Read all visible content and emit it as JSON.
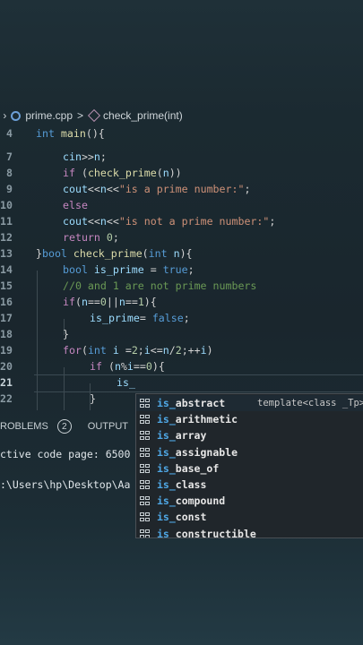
{
  "breadcrumb": {
    "prefix": "‹ ›",
    "file": "prime.cpp",
    "sep": ">",
    "symbol": "check_prime(int)"
  },
  "code_lines": [
    {
      "no": "4",
      "tokens": [
        [
          "kw",
          "int "
        ],
        [
          "fn",
          "main"
        ],
        [
          "pl",
          "(){"
        ]
      ]
    },
    {
      "no": "7",
      "tokens": [
        [
          "var",
          "cin"
        ],
        [
          "pl",
          ">>"
        ],
        [
          "var",
          "n"
        ],
        [
          "pl",
          ";"
        ]
      ]
    },
    {
      "no": "8",
      "tokens": [
        [
          "ctl",
          "if "
        ],
        [
          "pl",
          "("
        ],
        [
          "fn",
          "check_prime"
        ],
        [
          "pl",
          "("
        ],
        [
          "var",
          "n"
        ],
        [
          "pl",
          "))"
        ]
      ]
    },
    {
      "no": "9",
      "tokens": [
        [
          "var",
          "cout"
        ],
        [
          "pl",
          "<<"
        ],
        [
          "var",
          "n"
        ],
        [
          "pl",
          "<<"
        ],
        [
          "str",
          "\"is a prime number:\""
        ],
        [
          "pl",
          ";"
        ]
      ]
    },
    {
      "no": "10",
      "tokens": [
        [
          "ctl",
          "else"
        ]
      ]
    },
    {
      "no": "11",
      "tokens": [
        [
          "var",
          "cout"
        ],
        [
          "pl",
          "<<"
        ],
        [
          "var",
          "n"
        ],
        [
          "pl",
          "<<"
        ],
        [
          "str",
          "\"is not a prime number:\""
        ],
        [
          "pl",
          ";"
        ]
      ]
    },
    {
      "no": "12",
      "tokens": [
        [
          "ctl",
          "return "
        ],
        [
          "num",
          "0"
        ],
        [
          "pl",
          ";"
        ]
      ]
    },
    {
      "no": "13",
      "tokens": [
        [
          "pl",
          "}"
        ],
        [
          "kw",
          "bool "
        ],
        [
          "fn",
          "check_prime"
        ],
        [
          "pl",
          "("
        ],
        [
          "kw",
          "int "
        ],
        [
          "var",
          "n"
        ],
        [
          "pl",
          "){"
        ]
      ]
    },
    {
      "no": "14",
      "tokens": [
        [
          "kw",
          "bool "
        ],
        [
          "var",
          "is_prime"
        ],
        [
          "pl",
          " = "
        ],
        [
          "kw",
          "true"
        ],
        [
          "pl",
          ";"
        ]
      ]
    },
    {
      "no": "15",
      "tokens": [
        [
          "cm",
          "//0 and 1 are not prime numbers"
        ]
      ]
    },
    {
      "no": "16",
      "tokens": [
        [
          "ctl",
          "if"
        ],
        [
          "pl",
          "("
        ],
        [
          "var",
          "n"
        ],
        [
          "pl",
          "=="
        ],
        [
          "num",
          "0"
        ],
        [
          "pl",
          "||"
        ],
        [
          "var",
          "n"
        ],
        [
          "pl",
          "=="
        ],
        [
          "num",
          "1"
        ],
        [
          "pl",
          "){"
        ]
      ]
    },
    {
      "no": "17",
      "tokens": [
        [
          "var",
          "is_prime"
        ],
        [
          "pl",
          "= "
        ],
        [
          "kw",
          "false"
        ],
        [
          "pl",
          ";"
        ]
      ]
    },
    {
      "no": "18",
      "tokens": [
        [
          "pl",
          "}"
        ]
      ]
    },
    {
      "no": "19",
      "tokens": [
        [
          "ctl",
          "for"
        ],
        [
          "pl",
          "("
        ],
        [
          "kw",
          "int "
        ],
        [
          "var",
          "i"
        ],
        [
          "pl",
          " ="
        ],
        [
          "num",
          "2"
        ],
        [
          "pl",
          ";"
        ],
        [
          "var",
          "i"
        ],
        [
          "pl",
          "<="
        ],
        [
          "var",
          "n"
        ],
        [
          "pl",
          "/"
        ],
        [
          "num",
          "2"
        ],
        [
          "pl",
          ";++"
        ],
        [
          "var",
          "i"
        ],
        [
          "pl",
          ")"
        ]
      ]
    },
    {
      "no": "20",
      "tokens": [
        [
          "ctl",
          "if "
        ],
        [
          "pl",
          "("
        ],
        [
          "var",
          "n"
        ],
        [
          "pl",
          "%"
        ],
        [
          "var",
          "i"
        ],
        [
          "pl",
          "=="
        ],
        [
          "num",
          "0"
        ],
        [
          "pl",
          "){"
        ]
      ]
    },
    {
      "no": "21",
      "tokens": [
        [
          "var",
          "is_"
        ]
      ]
    },
    {
      "no": "22",
      "tokens": [
        [
          "pl",
          "}"
        ]
      ]
    }
  ],
  "panel": {
    "problems_label": "ROBLEMS",
    "problems_count": "2",
    "output_label": "OUTPUT",
    "terminal_line1": "ctive code page: 6500",
    "terminal_line2": ":\\Users\\hp\\Desktop\\Aa"
  },
  "suggestions": {
    "typed": "is_",
    "detail": "template<class _Tp>",
    "items": [
      "is_abstract",
      "is_arithmetic",
      "is_array",
      "is_assignable",
      "is_base_of",
      "is_class",
      "is_compound",
      "is_const",
      "is_constructible"
    ]
  },
  "colors": {
    "keyword": "#569cd6",
    "function": "#dcdcaa",
    "string": "#ce9178",
    "comment": "#6a9955",
    "control": "#c586c0",
    "variable": "#9cdcfe",
    "number": "#b5cea8"
  }
}
